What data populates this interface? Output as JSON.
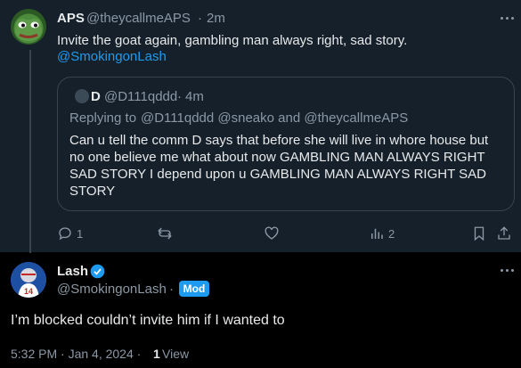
{
  "parent_tweet": {
    "author_name": "APS",
    "handle": "@theycallmeAPS",
    "separator": "·",
    "time": "2m",
    "text": "Invite the goat again, gambling man always right, sad story.",
    "mention": "@SmokingonLash",
    "avatar_icon": "pepe-frog-avatar"
  },
  "quoted_tweet": {
    "author_name": "D",
    "handle": "@D111qddd",
    "separator": "·",
    "time": "4m",
    "replying_to_prefix": "Replying to",
    "replying_to_users": "@D111qddd @sneako and @theycallmeAPS",
    "text_lines": [
      "Can u tell the comm D says that before she will live in whore house but",
      "no one believe me what about now GAMBLING MAN ALWAYS RIGHT",
      "SAD STORY I depend upon u GAMBLING MAN ALWAYS RIGHT SAD",
      "STORY"
    ]
  },
  "actions": {
    "reply_count": "1",
    "views_count": "2"
  },
  "reply_tweet": {
    "author_name": "Lash",
    "handle": "@SmokingonLash",
    "separator": "·",
    "badge": "Mod",
    "text": "I’m blocked couldn’t invite him if I wanted to",
    "timestamp": "5:32 PM · Jan 4, 2024 ·",
    "views_count": "1",
    "views_label": "View",
    "avatar_icon": "football-player-avatar"
  },
  "colors": {
    "background_top": "#15202b",
    "background_bottom": "#000000",
    "text_primary": "#e7e9ea",
    "text_muted": "#8b98a5",
    "accent": "#1d9bf0",
    "border": "#38444d"
  }
}
